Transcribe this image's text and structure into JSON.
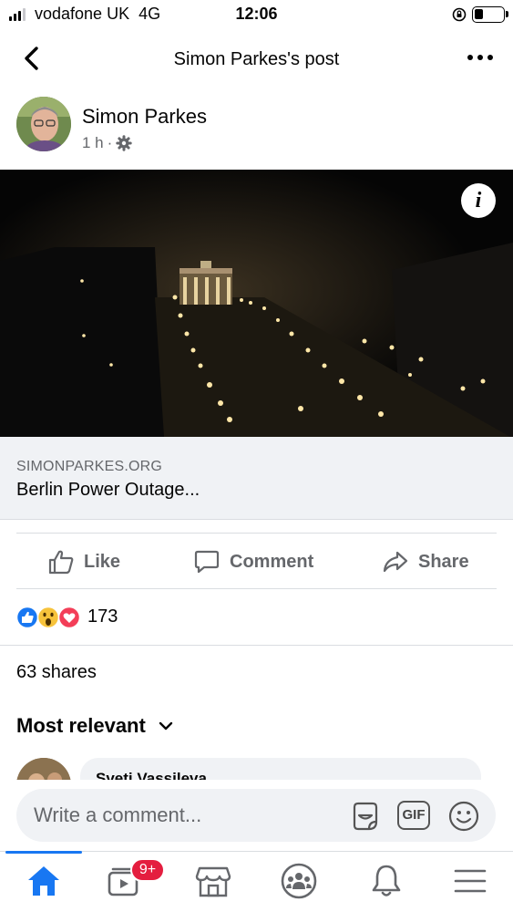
{
  "status_bar": {
    "carrier": "vodafone UK",
    "network": "4G",
    "time": "12:06"
  },
  "header": {
    "title": "Simon Parkes's post",
    "back_icon": "chevron-left-icon",
    "more_icon": "more-dots-icon"
  },
  "post": {
    "author": "Simon Parkes",
    "time_ago": "1 h",
    "separator": "·",
    "privacy_icon": "gear-icon",
    "info_label": "i",
    "link": {
      "domain": "SIMONPARKES.ORG",
      "title": "Berlin Power Outage..."
    }
  },
  "actions": {
    "like": "Like",
    "comment": "Comment",
    "share": "Share"
  },
  "reactions": {
    "types": [
      "like",
      "wow",
      "love"
    ],
    "count": "173"
  },
  "shares": "63 shares",
  "comments": {
    "sort_label": "Most relevant",
    "first_commenter": "Sveti Vassileva"
  },
  "composer": {
    "placeholder": "Write a comment...",
    "gif_label": "GIF"
  },
  "tab_bar": {
    "items": [
      "home-icon",
      "watch-icon",
      "marketplace-icon",
      "groups-icon",
      "notifications-icon",
      "menu-icon"
    ],
    "watch_badge": "9+",
    "active": "home",
    "accent_color": "#1877f2",
    "badge_color": "#e41e3f"
  }
}
